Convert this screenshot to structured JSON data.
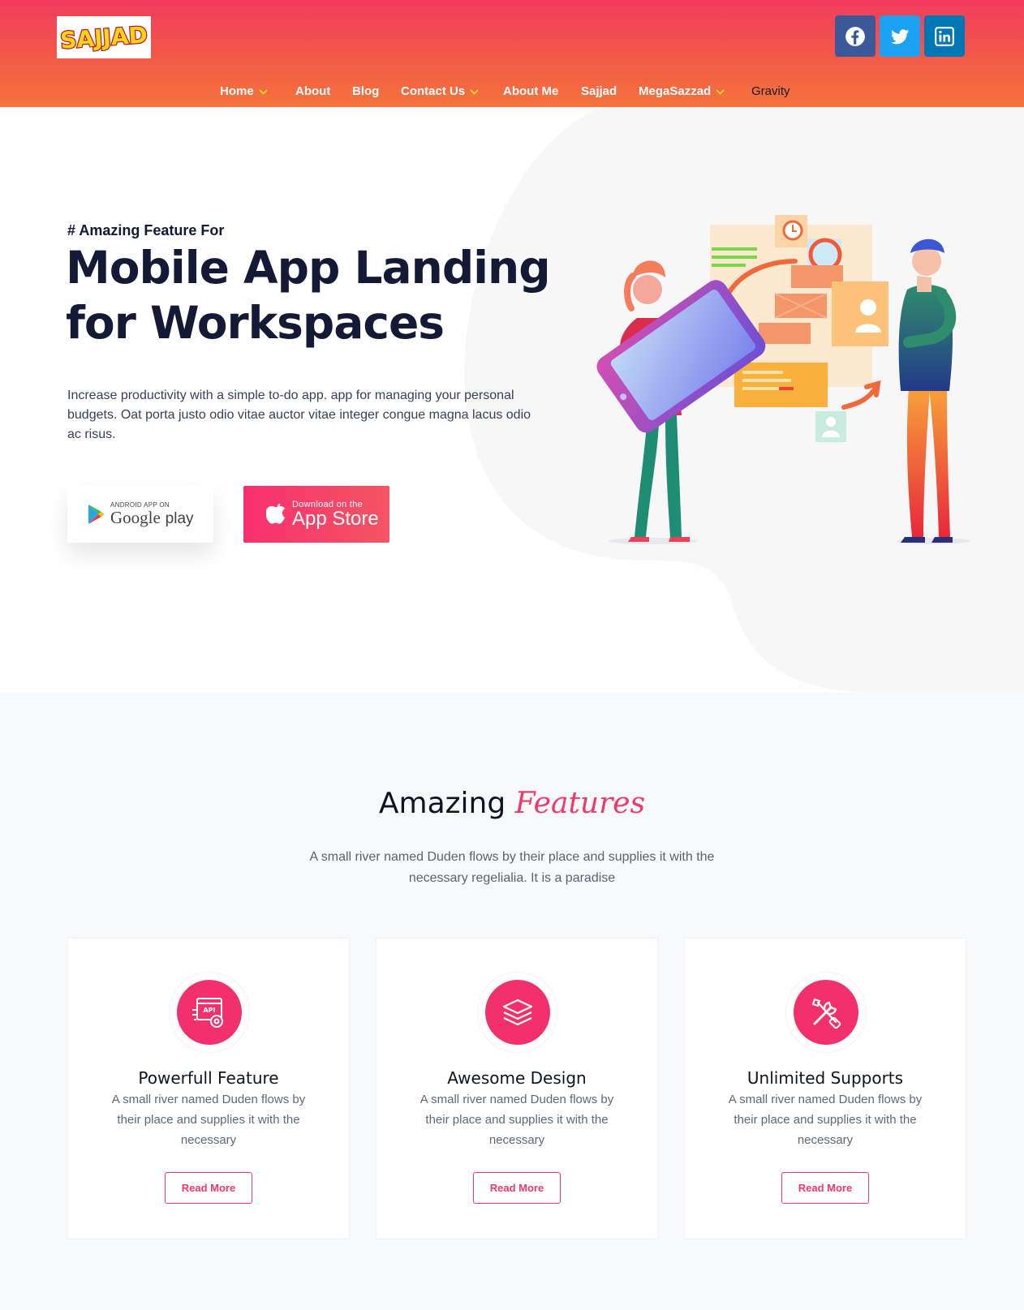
{
  "header": {
    "logo_text": "SAJJAD",
    "social": [
      {
        "name": "facebook",
        "icon": "facebook-icon",
        "color": "#3b5998"
      },
      {
        "name": "twitter",
        "icon": "twitter-icon",
        "color": "#1da1f2"
      },
      {
        "name": "linkedin",
        "icon": "linkedin-icon",
        "color": "#0077b5"
      }
    ],
    "nav": [
      {
        "label": "Home",
        "has_dropdown": true
      },
      {
        "label": "About",
        "has_dropdown": false
      },
      {
        "label": "Blog",
        "has_dropdown": false
      },
      {
        "label": "Contact Us",
        "has_dropdown": true
      },
      {
        "label": "About Me",
        "has_dropdown": false
      },
      {
        "label": "Sajjad",
        "has_dropdown": false
      },
      {
        "label": "MegaSazzad",
        "has_dropdown": true
      },
      {
        "label": "Gravity",
        "has_dropdown": false,
        "active": true
      }
    ],
    "gradient_top": "#f23b5d",
    "gradient_bottom": "#f5743c"
  },
  "hero": {
    "kicker": "# Amazing Feature For",
    "title_line1": "Mobile App Landing",
    "title_line2": "for Workspaces",
    "description": "Increase productivity with a simple to-do app. app for managing your personal budgets. Oat porta justo odio vitae auctor vitae integer congue magna lacus odio ac risus.",
    "google_play": {
      "small": "ANDROID APP ON",
      "big_part1": "Google",
      "big_part2": "play"
    },
    "app_store": {
      "small": "Download on the",
      "big": "App Store"
    }
  },
  "features": {
    "title_plain": "Amazing",
    "title_accent": "Features",
    "subtitle": "A small river named Duden flows by their place and supplies it with the necessary regelialia. It is a paradise",
    "accent_color": "#f0386a",
    "cards": [
      {
        "icon": "api-gear-icon",
        "title": "Powerfull Feature",
        "description": "A small river named Duden flows by their place and supplies it with the necessary",
        "button": "Read More"
      },
      {
        "icon": "layers-icon",
        "title": "Awesome Design",
        "description": "A small river named Duden flows by their place and supplies it with the necessary",
        "button": "Read More"
      },
      {
        "icon": "tools-icon",
        "title": "Unlimited Supports",
        "description": "A small river named Duden flows by their place and supplies it with the necessary",
        "button": "Read More"
      }
    ]
  }
}
